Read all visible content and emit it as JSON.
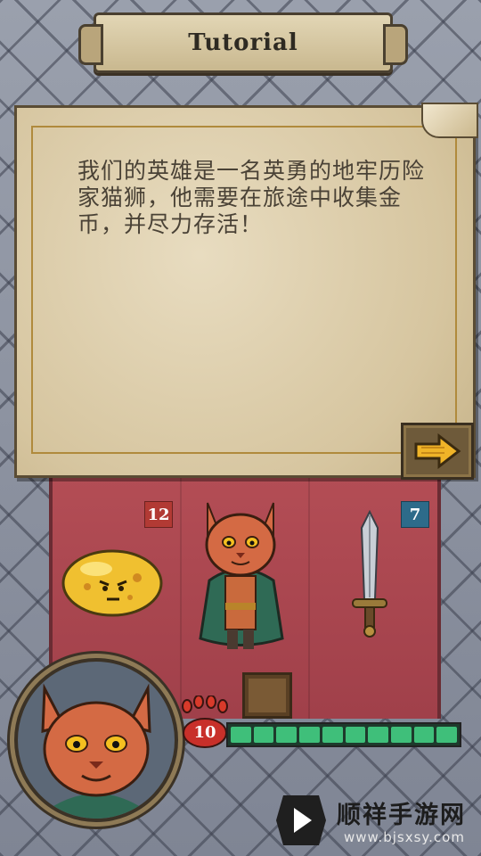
{
  "header": {
    "title": "Tutorial"
  },
  "dialog": {
    "text": "我们的英雄是一名英勇的地牢历险家猫狮，他需要在旅途中收集金币，并尽力存活！"
  },
  "buttons": {
    "next_icon": "arrow-right-icon"
  },
  "board": {
    "enemy": {
      "name_icon": "slime-icon",
      "value": "12"
    },
    "hero": {
      "name_icon": "cat-hero-icon"
    },
    "item": {
      "name_icon": "sword-icon",
      "value": "7"
    }
  },
  "player": {
    "hp": "10",
    "hp_segments_filled": 10,
    "hp_segments_total": 10
  },
  "watermark": {
    "name": "顺祥手游网",
    "url": "www.bjsxsy.com"
  },
  "colors": {
    "arena": "#a8444d",
    "hp": "#3fbf7a",
    "badge_red": "#b23a34",
    "badge_blue": "#2d6b8a"
  }
}
